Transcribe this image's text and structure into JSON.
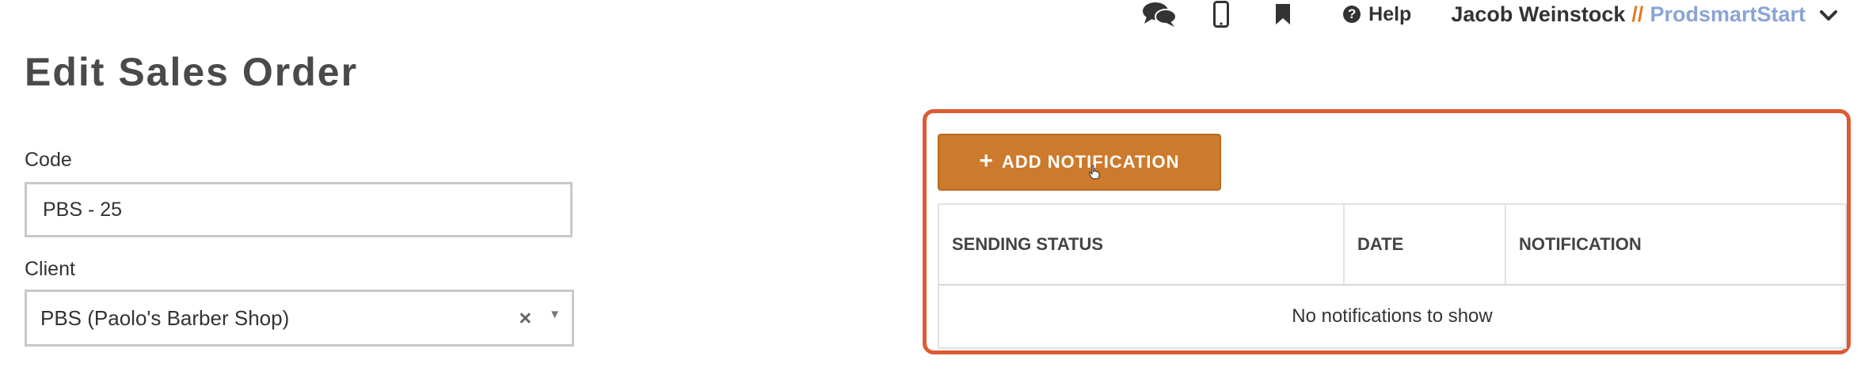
{
  "header": {
    "help_label": "Help",
    "user_name": "Jacob Weinstock",
    "separator": "//",
    "company": "ProdsmartStart",
    "icons": [
      "chat-icon",
      "mobile-icon",
      "bookmark-icon",
      "help-circle-icon",
      "chevron-down-icon"
    ]
  },
  "page": {
    "title": "Edit Sales Order"
  },
  "form": {
    "code_label": "Code",
    "code_value": "PBS - 25",
    "client_label": "Client",
    "client_value": "PBS (Paolo's Barber Shop)",
    "clear_symbol": "×",
    "caret_symbol": "▼"
  },
  "notifications": {
    "add_button_label": "ADD NOTIFICATION",
    "columns": [
      "SENDING STATUS",
      "DATE",
      "NOTIFICATION"
    ],
    "empty_message": "No notifications to show"
  },
  "colors": {
    "accent_orange": "#cc7a2b",
    "highlight_border": "#dd5a32",
    "company_blue": "#8aa4d4"
  }
}
